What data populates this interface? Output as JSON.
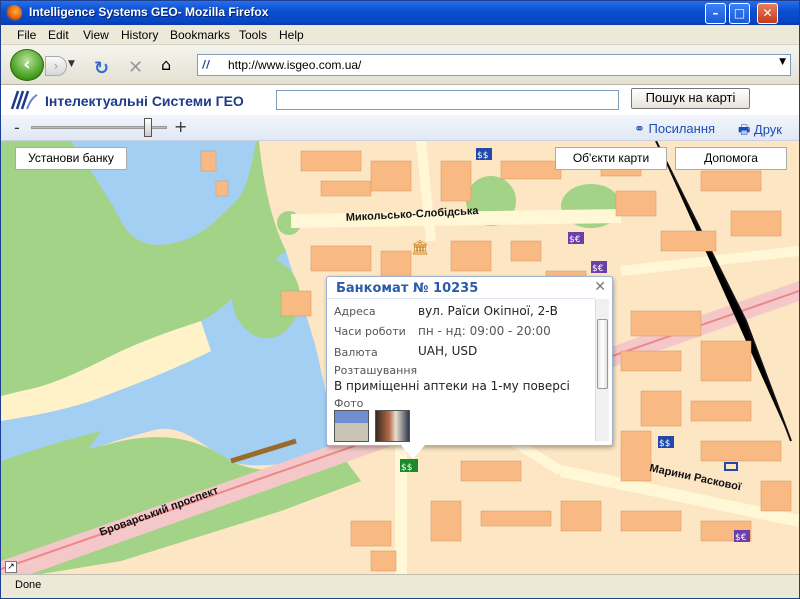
{
  "window": {
    "title": "Intelligence Systems GEO- Mozilla Firefox"
  },
  "menu": [
    "File",
    "Edit",
    "View",
    "History",
    "Bookmarks",
    "Tools",
    "Help"
  ],
  "nav": {
    "url": "http://www.isgeo.com.ua/"
  },
  "site": {
    "logo_text": "Інтелектуальні Системи ГЕО",
    "search_placeholder": "",
    "search_button": "Пошук на карті",
    "link_label": "Посилання",
    "print_label": "Друк",
    "zoom_minus": "-",
    "zoom_plus": "+",
    "zoom_level": 0.88
  },
  "map": {
    "buttons": {
      "bank": "Установи банку",
      "objects": "Об'єкти карти",
      "help": "Допомога"
    },
    "streets": [
      "Микольсько-Слобідська",
      "Броварський проспект",
      "Марини Раскової"
    ],
    "colors": {
      "water": "#a2cff2",
      "park": "#a2d386",
      "land": "#fce6c4",
      "building": "#f9b982",
      "road": "#fff7d6"
    }
  },
  "popup": {
    "title": "Банкомат № 10235",
    "address_label": "Адреса",
    "address": "вул. Раїси Окіпної, 2-В",
    "hours_label": "Часи роботи",
    "hours": "пн - нд: 09:00 - 20:00",
    "currency_label": "Валюта",
    "currency": "UAH, USD",
    "location_label": "Розташування",
    "location": "В приміщенні аптеки на 1-му поверсі",
    "photo_label": "Фото"
  },
  "status": {
    "text": "Done"
  }
}
